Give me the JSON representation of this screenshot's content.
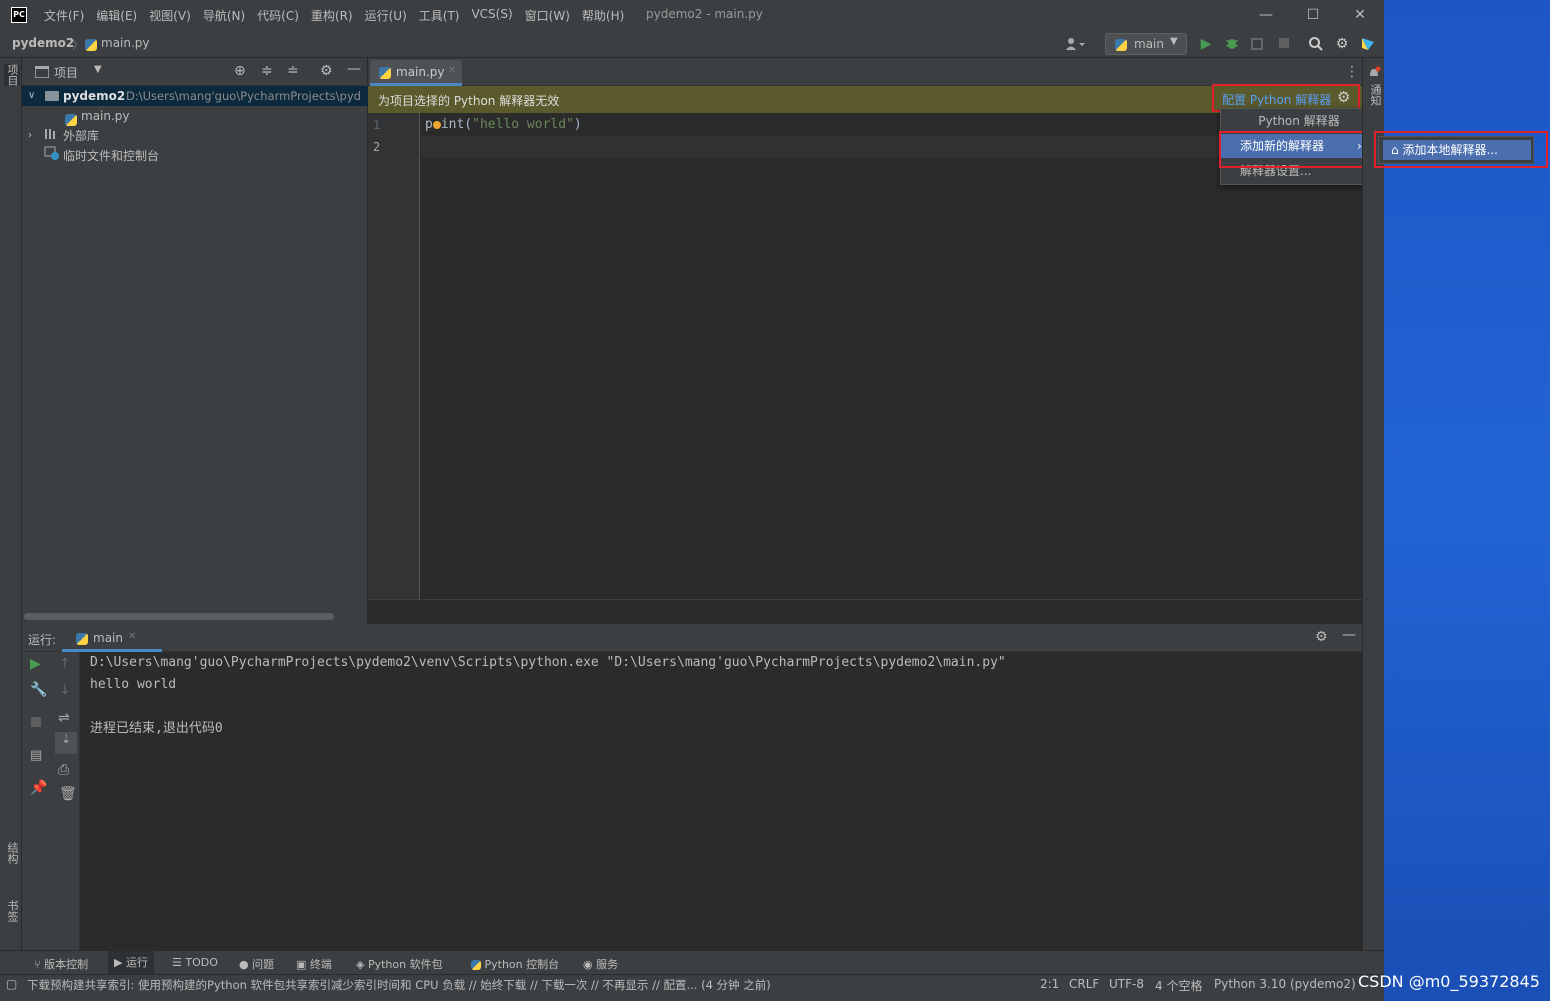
{
  "titlebar": {
    "logo": "PC",
    "menu": [
      "文件(F)",
      "编辑(E)",
      "视图(V)",
      "导航(N)",
      "代码(C)",
      "重构(R)",
      "运行(U)",
      "工具(T)",
      "VCS(S)",
      "窗口(W)",
      "帮助(H)"
    ],
    "window_title": "pydemo2 - main.py",
    "minimize": "—",
    "maximize": "☐",
    "close": "✕"
  },
  "navbar": {
    "project": "pydemo2",
    "separator": "〉",
    "file": "main.py",
    "run_config": "main"
  },
  "left_strip": {
    "project_label": "项目",
    "structure_label": "结构",
    "bookmarks_label": "书签"
  },
  "project_panel": {
    "title": "项目",
    "root_name": "pydemo2",
    "root_path": "D:\\Users\\mang'guo\\PycharmProjects\\pyd",
    "file": "main.py",
    "external_libs": "外部库",
    "scratches": "临时文件和控制台"
  },
  "editor": {
    "tab_label": "main.py",
    "banner_text": "为项目选择的 Python 解释器无效",
    "configure_link": "配置 Python 解释器",
    "line_numbers": [
      "1",
      "2"
    ],
    "code_line1_a": "p",
    "code_line1_b": "int(",
    "code_line1_str": "\"hello world\"",
    "code_line1_c": ")"
  },
  "popup": {
    "header": "Python 解释器",
    "add_new": "添加新的解释器",
    "settings": "解释器设置...",
    "submenu_item": "添加本地解释器..."
  },
  "right_strip": {
    "notifications_label": "通知"
  },
  "run_panel": {
    "label": "运行:",
    "tab": "main",
    "lines": [
      "D:\\Users\\mang'guo\\PycharmProjects\\pydemo2\\venv\\Scripts\\python.exe \"D:\\Users\\mang'guo\\PycharmProjects\\pydemo2\\main.py\"",
      "hello world",
      "",
      "进程已结束,退出代码0"
    ]
  },
  "bottom_tabs": [
    "版本控制",
    "运行",
    "TODO",
    "问题",
    "终端",
    "Python 软件包",
    "Python 控制台",
    "服务"
  ],
  "statusbar": {
    "message": "下载预构建共享索引: 使用预构建的Python 软件包共享索引减少索引时间和 CPU 负载 // 始终下载 // 下载一次 // 不再显示 // 配置... (4 分钟 之前)",
    "position": "2:1",
    "line_sep": "CRLF",
    "encoding": "UTF-8",
    "indent": "4 个空格",
    "interpreter": "Python 3.10 (pydemo2)"
  },
  "watermark": "CSDN @m0_59372845",
  "colors": {
    "ide_bg": "#3c3f41",
    "editor_bg": "#2b2b2b",
    "banner_bg": "#5a5a2c",
    "link": "#589df6",
    "selected": "#4b6eaf",
    "highlight_box": "#e0202a"
  }
}
